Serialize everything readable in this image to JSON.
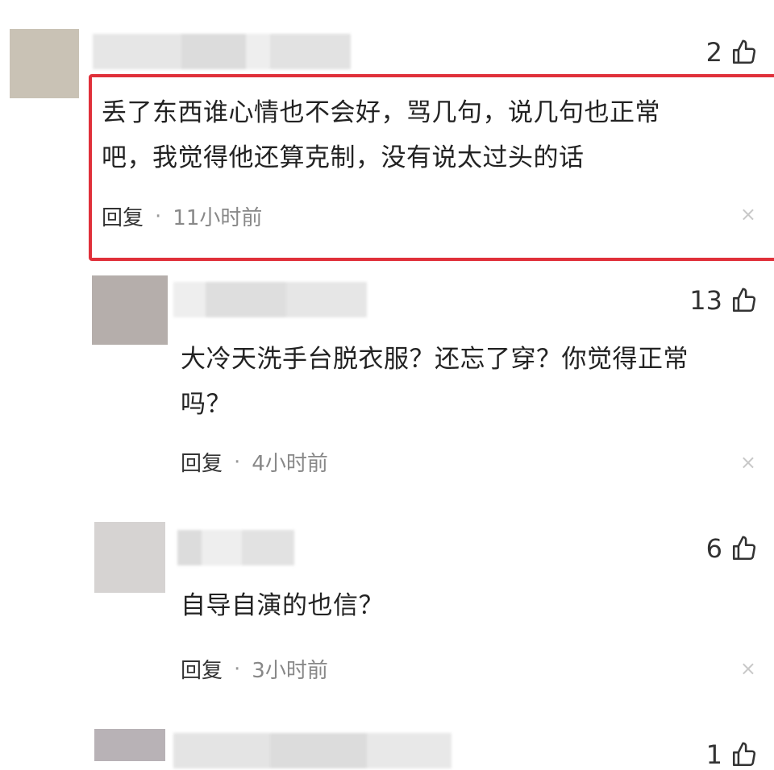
{
  "comments": [
    {
      "likes": "2",
      "text_line1": "丢了东西谁心情也不会好，骂几句，说几句也正常",
      "text_line2": "吧，我觉得他还算克制，没有说太过头的话",
      "reply_label": "回复",
      "separator": "·",
      "time": "11小时前",
      "close": "×",
      "avatar_color": "#c9c2b5",
      "highlighted": true,
      "highlight_color": "#e0303a"
    },
    {
      "likes": "13",
      "text_line1": "大冷天洗手台脱衣服？还忘了穿？你觉得正常",
      "text_line2": "吗？",
      "reply_label": "回复",
      "separator": "·",
      "time": "4小时前",
      "close": "×",
      "avatar_color": "#b5aeab"
    },
    {
      "likes": "6",
      "text_line1": "自导自演的也信？",
      "reply_label": "回复",
      "separator": "·",
      "time": "3小时前",
      "close": "×",
      "avatar_color": "#d6d3d2"
    },
    {
      "likes": "1",
      "avatar_color": "#b8b2b6"
    }
  ],
  "icons": {
    "like": "thumbs-up-icon",
    "close": "close-icon"
  }
}
